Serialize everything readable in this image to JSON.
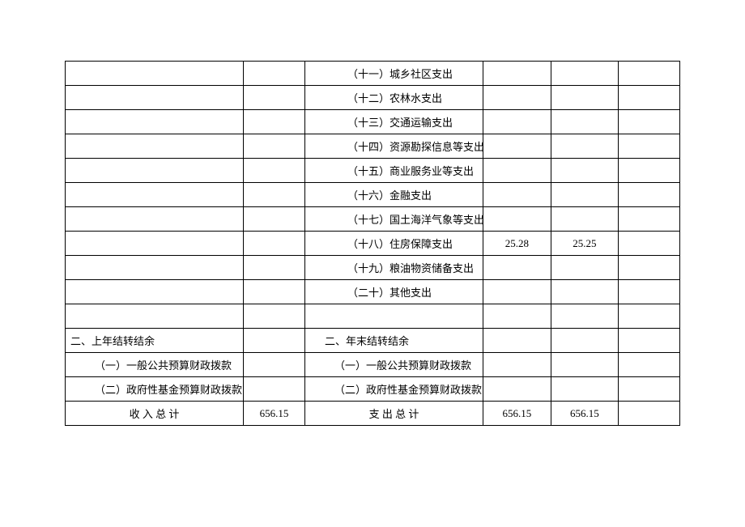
{
  "rows": [
    {
      "left_label": "",
      "left_val": "",
      "right_label": "（十一）城乡社区支出",
      "c4": "",
      "c5": "",
      "c6": ""
    },
    {
      "left_label": "",
      "left_val": "",
      "right_label": "（十二）农林水支出",
      "c4": "",
      "c5": "",
      "c6": ""
    },
    {
      "left_label": "",
      "left_val": "",
      "right_label": "（十三）交通运输支出",
      "c4": "",
      "c5": "",
      "c6": ""
    },
    {
      "left_label": "",
      "left_val": "",
      "right_label": "（十四）资源勘探信息等支出",
      "c4": "",
      "c5": "",
      "c6": ""
    },
    {
      "left_label": "",
      "left_val": "",
      "right_label": "（十五）商业服务业等支出",
      "c4": "",
      "c5": "",
      "c6": ""
    },
    {
      "left_label": "",
      "left_val": "",
      "right_label": "（十六）金融支出",
      "c4": "",
      "c5": "",
      "c6": ""
    },
    {
      "left_label": "",
      "left_val": "",
      "right_label": "（十七）国土海洋气象等支出",
      "c4": "",
      "c5": "",
      "c6": ""
    },
    {
      "left_label": "",
      "left_val": "",
      "right_label": "（十八）住房保障支出",
      "c4": "25.28",
      "c5": "25.25",
      "c6": ""
    },
    {
      "left_label": "",
      "left_val": "",
      "right_label": "（十九）粮油物资储备支出",
      "c4": "",
      "c5": "",
      "c6": ""
    },
    {
      "left_label": "",
      "left_val": "",
      "right_label": "（二十）其他支出",
      "c4": "",
      "c5": "",
      "c6": ""
    }
  ],
  "section2": {
    "left_header": "二、上年结转结余",
    "right_header": "二、年末结转结余",
    "sub": [
      {
        "left": "（一）一般公共预算财政拨款",
        "right": "（一）一般公共预算财政拨款"
      },
      {
        "left": "（二）政府性基金预算财政拨款",
        "right": "（二）政府性基金预算财政拨款"
      }
    ]
  },
  "totals": {
    "income_label": "收 入 总 计",
    "income_val": "656.15",
    "expense_label": "支 出 总 计",
    "expense_c4": "656.15",
    "expense_c5": "656.15",
    "expense_c6": ""
  }
}
